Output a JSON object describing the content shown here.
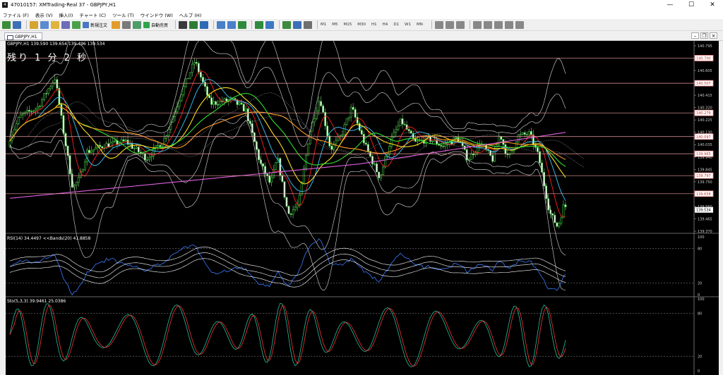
{
  "window": {
    "title": "47010157: XMTrading-Real 37 - GBPJPY,H1",
    "minimize": "—",
    "maximize": "☐",
    "close": "✕"
  },
  "menu": [
    "ファイル (F)",
    "表示 (V)",
    "挿入(I)",
    "チャート (C)",
    "ツール (T)",
    "ウインドウ (W)",
    "ヘルプ (H)"
  ],
  "toolbar": {
    "new_order": "新規注文",
    "auto_trade": "自動売買",
    "timeframes": [
      "M1",
      "M5",
      "M15",
      "M30",
      "H1",
      "H4",
      "D1",
      "W1",
      "MN"
    ]
  },
  "chart": {
    "tab": "GBPJPY,H1",
    "header": "GBPJPY,H1  139.590 139.654 139.496 139.534",
    "countdown": "残り 1 分 2 秒",
    "rsi_label": "RSI(14) 34.4497  <<Bands(20) 41.8858",
    "stoch_label": "Sto(5,3,3) 39.9461 25.0386",
    "price_axis": [
      "140.795",
      "140.700",
      "140.605",
      "140.510",
      "140.415",
      "140.320",
      "140.225",
      "140.130",
      "140.035",
      "139.940",
      "139.845",
      "139.750",
      "139.655",
      "139.560",
      "139.465",
      "139.370"
    ],
    "level_tags": [
      {
        "price": 140.7,
        "label": "140.700",
        "color": "#f08080"
      },
      {
        "price": 140.507,
        "label": "140.507",
        "color": "#f08080"
      },
      {
        "price": 140.279,
        "label": "140.279",
        "color": "#f08080"
      },
      {
        "price": 140.097,
        "label": "140.097",
        "color": "#f08080"
      },
      {
        "price": 139.965,
        "label": "139.965",
        "color": "#f08080"
      },
      {
        "price": 139.797,
        "label": "139.797",
        "color": "#f08080"
      },
      {
        "price": 139.658,
        "label": "139.658",
        "color": "#f08080"
      }
    ],
    "current_price": "139.534",
    "rsi_axis": [
      "100",
      "80",
      "20",
      "0"
    ],
    "stoch_axis": [
      "100",
      "80",
      "20",
      "0"
    ]
  },
  "chart_data": {
    "type": "line",
    "title": "GBPJPY,H1",
    "ylim": [
      139.37,
      140.8
    ],
    "series": [
      {
        "name": "GBPJPY,H1",
        "type": "candlestick"
      }
    ],
    "last": {
      "open": 139.59,
      "high": 139.654,
      "low": 139.496,
      "close": 139.534
    }
  }
}
